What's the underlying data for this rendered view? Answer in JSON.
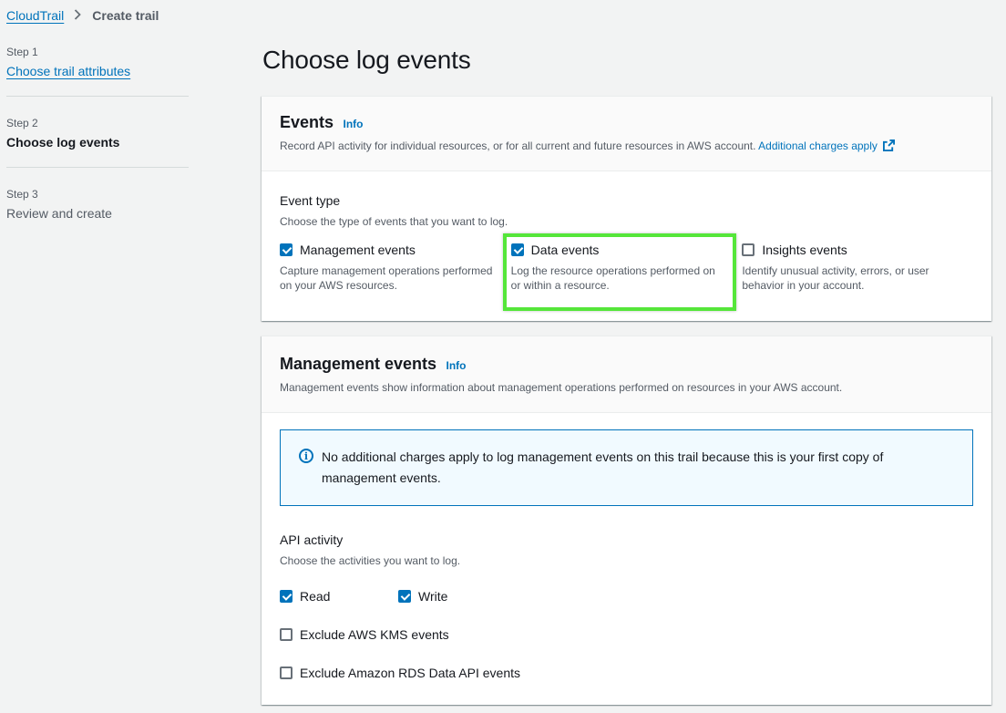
{
  "breadcrumb": {
    "root": "CloudTrail",
    "current": "Create trail"
  },
  "steps": [
    {
      "num": "Step 1",
      "title": "Choose trail attributes"
    },
    {
      "num": "Step 2",
      "title": "Choose log events"
    },
    {
      "num": "Step 3",
      "title": "Review and create"
    }
  ],
  "page": {
    "title": "Choose log events"
  },
  "events_panel": {
    "title": "Events",
    "info": "Info",
    "description": "Record API activity for individual resources, or for all current and future resources in AWS account.",
    "charges_link": "Additional charges apply",
    "event_type_label": "Event type",
    "event_type_desc": "Choose the type of events that you want to log.",
    "types": [
      {
        "label": "Management events",
        "desc": "Capture management operations performed on your AWS resources.",
        "checked": true
      },
      {
        "label": "Data events",
        "desc": "Log the resource operations performed on or within a resource.",
        "checked": true
      },
      {
        "label": "Insights events",
        "desc": "Identify unusual activity, errors, or user behavior in your account.",
        "checked": false
      }
    ]
  },
  "mgmt_panel": {
    "title": "Management events",
    "info": "Info",
    "description": "Management events show information about management operations performed on resources in your AWS account.",
    "alert": "No additional charges apply to log management events on this trail because this is your first copy of management events.",
    "api_label": "API activity",
    "api_desc": "Choose the activities you want to log.",
    "read": "Read",
    "write": "Write",
    "exclude_kms": "Exclude AWS KMS events",
    "exclude_rds": "Exclude Amazon RDS Data API events"
  },
  "colors": {
    "link": "#0073bb",
    "highlight": "#55e63a"
  }
}
